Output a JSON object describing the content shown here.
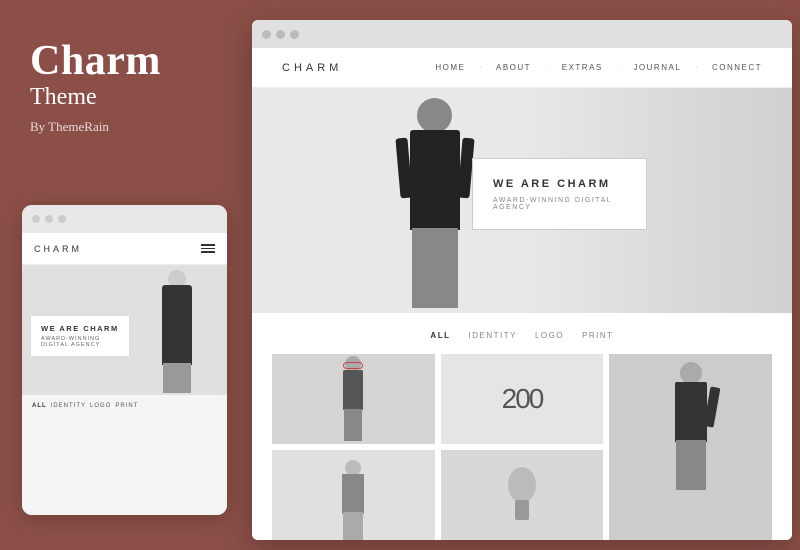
{
  "sidebar": {
    "title": "Charm",
    "subtitle": "Theme",
    "author": "By ThemeRain"
  },
  "mobile_preview": {
    "titlebar_dots": [
      "dot1",
      "dot2",
      "dot3"
    ],
    "nav_logo": "CHARM",
    "hero_heading": "WE ARE CHARM",
    "hero_subtext": "AWARD-WINNING DIGITAL AGENCY",
    "filters": [
      "ALL",
      "IDENTITY",
      "LOGO",
      "PRINT"
    ]
  },
  "desktop_preview": {
    "titlebar_dots": [
      "dot1",
      "dot2",
      "dot3"
    ],
    "nav_logo": "CHARM",
    "nav_links": [
      "HOME",
      "ABOUT",
      "EXTRAS",
      "JOURNAL",
      "CONNECT"
    ],
    "hero_heading": "WE ARE CHARM",
    "hero_subtext": "AWARD-WINNING DIGITAL AGENCY",
    "filters": [
      "ALL",
      "IDENTITY",
      "LOGO",
      "PRINT"
    ],
    "grid_number": "200"
  },
  "colors": {
    "sidebar_bg": "#8B4F47",
    "preview_bg": "#f5f5f5",
    "titlebar_bg": "#e0e0e0"
  }
}
